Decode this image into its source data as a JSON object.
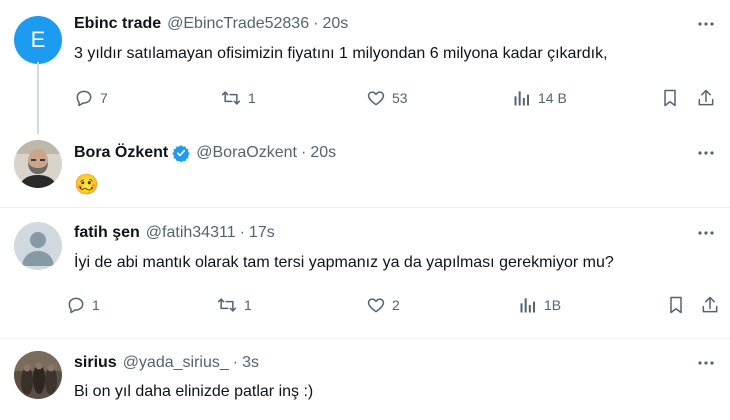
{
  "tweets": [
    {
      "avatar_letter": "E",
      "name": "Ebinc trade",
      "handle": "@EbincTrade52836",
      "time": "20s",
      "text": "3 yıldır satılamayan ofisimizin fiyatını 1 milyondan 6 milyona kadar çıkardık,",
      "replies": "7",
      "retweets": "1",
      "likes": "53",
      "views": "14 B"
    },
    {
      "name": "Bora Özkent",
      "handle": "@BoraOzkent",
      "time": "20s",
      "text": "🥴"
    },
    {
      "name": "fatih şen",
      "handle": "@fatih34311",
      "time": "17s",
      "text": "İyi de abi mantık olarak tam tersi yapmanız ya da yapılması gerekmiyor mu?",
      "replies": "1",
      "retweets": "1",
      "likes": "2",
      "views": "1B"
    },
    {
      "name": "sirius",
      "handle": "@yada_sirius_",
      "time": "3s",
      "text": "Bi on yıl daha elinizde patlar inş :)"
    }
  ],
  "separator": "·",
  "colors": {
    "accent": "#1d9bf0",
    "muted": "#536471",
    "text": "#0f1419",
    "divider": "#eff3f4"
  }
}
